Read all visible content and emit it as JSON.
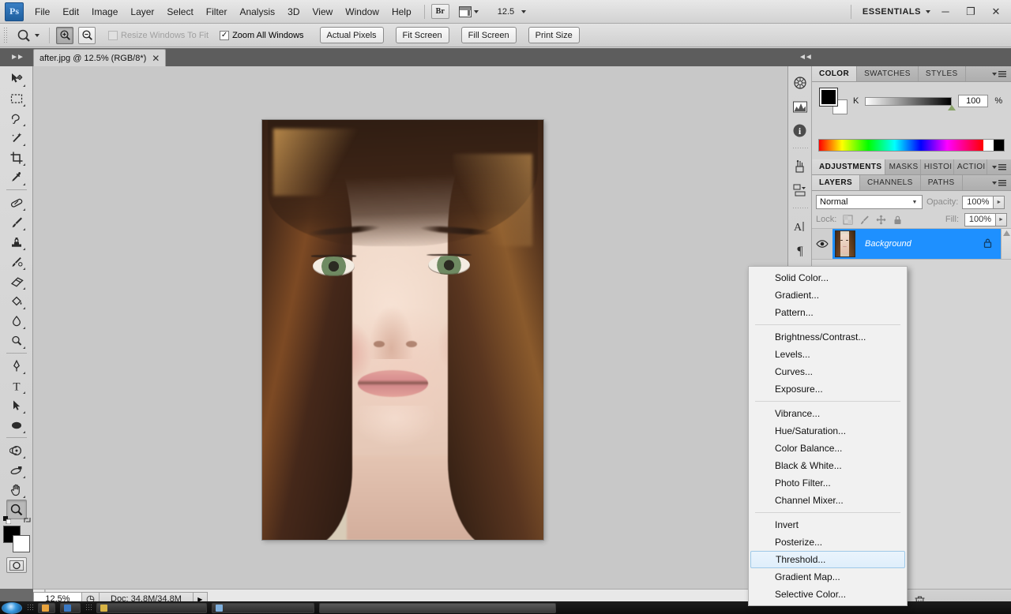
{
  "app": {
    "name": "Adobe Photoshop",
    "logo_text": "Ps",
    "workspace": "ESSENTIALS",
    "workspace_caret": "▼"
  },
  "menubar": {
    "items": [
      {
        "label": "File"
      },
      {
        "label": "Edit"
      },
      {
        "label": "Image"
      },
      {
        "label": "Layer"
      },
      {
        "label": "Select"
      },
      {
        "label": "Filter"
      },
      {
        "label": "Analysis"
      },
      {
        "label": "3D"
      },
      {
        "label": "View"
      },
      {
        "label": "Window"
      },
      {
        "label": "Help"
      }
    ],
    "bridge_label": "Br",
    "zoom_level": "12.5",
    "caret": "▼"
  },
  "window_controls": {
    "minimize": "─",
    "restore": "❐",
    "close": "✕"
  },
  "options_bar": {
    "tool_icon": "zoom-tool-icon",
    "zoom_in_icon": "zoom-in-icon",
    "zoom_out_icon": "zoom-out-icon",
    "resize_windows": {
      "label": "Resize Windows To Fit",
      "checked": false,
      "enabled": false
    },
    "zoom_all_windows": {
      "label": "Zoom All Windows",
      "checked": true,
      "enabled": true,
      "check_glyph": "✓"
    },
    "buttons": [
      {
        "label": "Actual Pixels"
      },
      {
        "label": "Fit Screen"
      },
      {
        "label": "Fill Screen"
      },
      {
        "label": "Print Size"
      }
    ]
  },
  "document": {
    "tab_title": "after.jpg @ 12.5% (RGB/8*)",
    "close_glyph": "✕"
  },
  "toolbar": {
    "tools": [
      {
        "name": "move-tool",
        "has_submenu": true
      },
      {
        "name": "rectangular-marquee-tool",
        "has_submenu": true
      },
      {
        "name": "lasso-tool",
        "has_submenu": true
      },
      {
        "name": "magic-wand-tool",
        "has_submenu": true
      },
      {
        "name": "crop-tool",
        "has_submenu": true
      },
      {
        "name": "eyedropper-tool",
        "has_submenu": true
      },
      {
        "name": "spot-healing-brush-tool",
        "has_submenu": true
      },
      {
        "name": "brush-tool",
        "has_submenu": true
      },
      {
        "name": "clone-stamp-tool",
        "has_submenu": true
      },
      {
        "name": "history-brush-tool",
        "has_submenu": true
      },
      {
        "name": "eraser-tool",
        "has_submenu": true
      },
      {
        "name": "gradient-tool",
        "has_submenu": true
      },
      {
        "name": "blur-tool",
        "has_submenu": true
      },
      {
        "name": "dodge-tool",
        "has_submenu": true
      },
      {
        "name": "pen-tool",
        "has_submenu": true
      },
      {
        "name": "horizontal-type-tool",
        "has_submenu": true
      },
      {
        "name": "path-selection-tool",
        "has_submenu": true
      },
      {
        "name": "ellipse-shape-tool",
        "has_submenu": true
      },
      {
        "name": "3d-rotate-tool",
        "has_submenu": true
      },
      {
        "name": "3d-orbit-tool",
        "has_submenu": true
      },
      {
        "name": "hand-tool",
        "has_submenu": true
      },
      {
        "name": "zoom-tool",
        "has_submenu": false,
        "selected": true
      }
    ],
    "foreground_color": "#000000",
    "background_color": "#ffffff",
    "quick_mask_label": "quick-mask-mode"
  },
  "status_bar": {
    "zoom": "12.5%",
    "doc_info": "Doc: 34.8M/34.8M",
    "arrow_glyph": "▶",
    "scroll_left_glyph": "◀"
  },
  "icon_dock": [
    {
      "name": "navigator-icon"
    },
    {
      "name": "histogram-icon"
    },
    {
      "name": "info-icon"
    },
    {
      "name": "brush-presets-icon"
    },
    {
      "name": "clone-source-icon"
    },
    {
      "name": "character-icon",
      "glyph": "A"
    },
    {
      "name": "paragraph-icon",
      "glyph": "¶"
    }
  ],
  "color_panel": {
    "tabs": [
      {
        "label": "COLOR",
        "active": true
      },
      {
        "label": "SWATCHES",
        "active": false
      },
      {
        "label": "STYLES",
        "active": false
      }
    ],
    "channel_label": "K",
    "value": "100",
    "unit": "%",
    "foreground": "#000000",
    "background": "#ffffff"
  },
  "adjustments_panel": {
    "tabs": [
      {
        "label": "ADJUSTMENTS",
        "active": true
      },
      {
        "label": "MASKS",
        "active": false
      },
      {
        "label": "HISTOI",
        "active": false
      },
      {
        "label": "ACTIOI",
        "active": false
      }
    ]
  },
  "layers_panel": {
    "tabs": [
      {
        "label": "LAYERS",
        "active": true
      },
      {
        "label": "CHANNELS",
        "active": false
      },
      {
        "label": "PATHS",
        "active": false
      }
    ],
    "blend_mode": "Normal",
    "opacity_label": "Opacity:",
    "opacity_value": "100%",
    "lock_label": "Lock:",
    "fill_label": "Fill:",
    "fill_value": "100%",
    "lock_icons": [
      {
        "name": "lock-transparent-pixels-icon"
      },
      {
        "name": "lock-image-pixels-icon"
      },
      {
        "name": "lock-position-icon"
      },
      {
        "name": "lock-all-icon"
      }
    ],
    "layers": [
      {
        "name": "Background",
        "visible": true,
        "locked": true,
        "selected": true,
        "visibility_icon": "eye-icon",
        "lock_icon": "lock-icon"
      }
    ],
    "bottom_icons": [
      {
        "name": "new-adjustment-layer-icon"
      },
      {
        "name": "new-group-icon"
      },
      {
        "name": "new-layer-icon"
      },
      {
        "name": "delete-layer-icon"
      }
    ]
  },
  "context_menu": {
    "name": "adjustment-layer-menu",
    "groups": [
      {
        "items": [
          {
            "label": "Solid Color...",
            "highlighted": false
          },
          {
            "label": "Gradient...",
            "highlighted": false
          },
          {
            "label": "Pattern...",
            "highlighted": false
          }
        ]
      },
      {
        "items": [
          {
            "label": "Brightness/Contrast...",
            "highlighted": false
          },
          {
            "label": "Levels...",
            "highlighted": false
          },
          {
            "label": "Curves...",
            "highlighted": false
          },
          {
            "label": "Exposure...",
            "highlighted": false
          }
        ]
      },
      {
        "items": [
          {
            "label": "Vibrance...",
            "highlighted": false
          },
          {
            "label": "Hue/Saturation...",
            "highlighted": false
          },
          {
            "label": "Color Balance...",
            "highlighted": false
          },
          {
            "label": "Black & White...",
            "highlighted": false
          },
          {
            "label": "Photo Filter...",
            "highlighted": false
          },
          {
            "label": "Channel Mixer...",
            "highlighted": false
          }
        ]
      },
      {
        "items": [
          {
            "label": "Invert",
            "highlighted": false
          },
          {
            "label": "Posterize...",
            "highlighted": false
          },
          {
            "label": "Threshold...",
            "highlighted": true
          },
          {
            "label": "Gradient Map...",
            "highlighted": false
          },
          {
            "label": "Selective Color...",
            "highlighted": false
          }
        ]
      }
    ]
  },
  "canvas": {
    "image_description": "portrait-photo-young-woman",
    "background_color": "#c8c8c8"
  },
  "colors": {
    "selection_blue": "#1e90ff",
    "menu_highlight": "#dfeefb",
    "panel_gray": "#d4d4d4",
    "canvas_gray": "#c8c8c8"
  }
}
